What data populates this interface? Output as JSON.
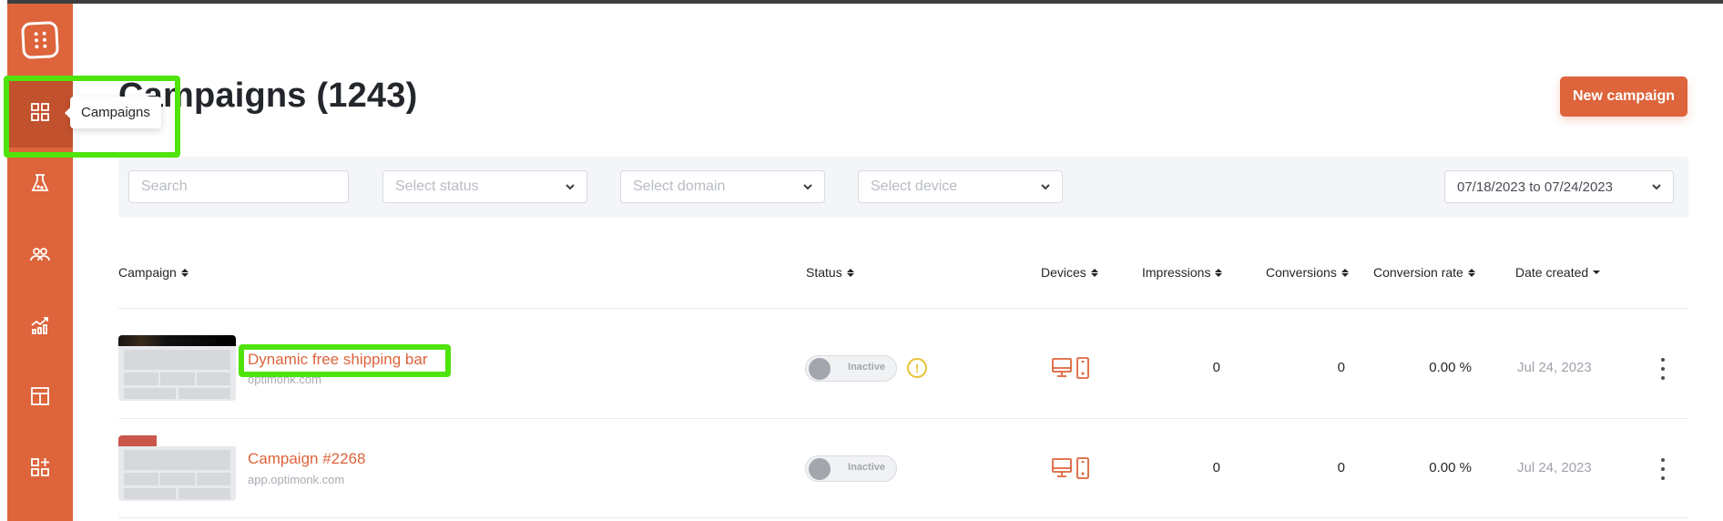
{
  "sidebar": {
    "items": [
      {
        "name": "campaigns",
        "icon": "grid-icon",
        "active": true
      },
      {
        "name": "experiments",
        "icon": "flask-icon",
        "active": false
      },
      {
        "name": "subscribers",
        "icon": "users-icon",
        "active": false
      },
      {
        "name": "analytics",
        "icon": "chart-icon",
        "active": false
      },
      {
        "name": "templates",
        "icon": "layout-icon",
        "active": false
      },
      {
        "name": "integrations",
        "icon": "add-apps-icon",
        "active": false
      }
    ],
    "tooltip": "Campaigns"
  },
  "header": {
    "title": "Campaigns (1243)",
    "new_campaign_label": "New campaign"
  },
  "filters": {
    "search_placeholder": "Search",
    "status_placeholder": "Select status",
    "domain_placeholder": "Select domain",
    "device_placeholder": "Select device",
    "date_range": "07/18/2023 to 07/24/2023"
  },
  "table": {
    "columns": [
      "Campaign",
      "Status",
      "Devices",
      "Impressions",
      "Conversions",
      "Conversion rate",
      "Date created"
    ],
    "rows": [
      {
        "name": "Dynamic free shipping bar",
        "domain": "optimonk.com",
        "status": "Inactive",
        "warning": "!",
        "devices": [
          "desktop",
          "mobile"
        ],
        "impressions": "0",
        "conversions": "0",
        "conversion_rate": "0.00 %",
        "date_created": "Jul 24, 2023"
      },
      {
        "name": "Campaign #2268",
        "domain": "app.optimonk.com",
        "status": "Inactive",
        "devices": [
          "desktop",
          "mobile"
        ],
        "impressions": "0",
        "conversions": "0",
        "conversion_rate": "0.00 %",
        "date_created": "Jul 24, 2023"
      }
    ]
  },
  "colors": {
    "brand": "#dd643b",
    "brand_dark": "#c2512e",
    "highlight": "#4fe30a",
    "warning": "#e8c334"
  }
}
